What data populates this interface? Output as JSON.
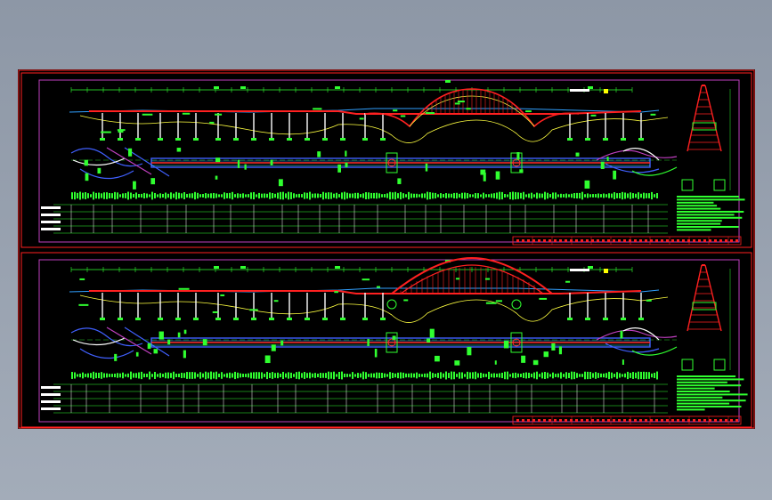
{
  "drawing": {
    "background": "#000000",
    "sheets": [
      {
        "name": "upper-sheet"
      },
      {
        "name": "lower-sheet"
      }
    ],
    "colors": {
      "frame_outer": "#ff2020",
      "frame_inner": "#c040c0",
      "elevation_line": "#30a0ff",
      "arch": "#ff2020",
      "pier": "#ffffff",
      "annotation": "#30ff30",
      "plan_road": "#4060ff",
      "plan_deck": "#ff3030",
      "ground": "#ffff40",
      "text_marker": "#ffff00"
    },
    "icons": [
      "bridge-elevation-drawing",
      "bridge-plan-drawing",
      "tower-section-drawing",
      "data-table-grid"
    ]
  }
}
